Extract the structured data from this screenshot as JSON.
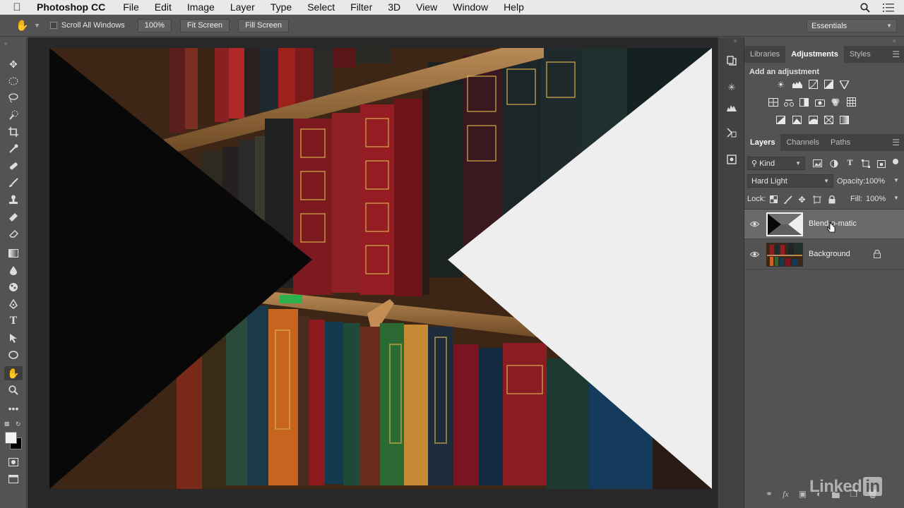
{
  "menubar": {
    "app_name": "Photoshop CC",
    "items": [
      "File",
      "Edit",
      "Image",
      "Layer",
      "Type",
      "Select",
      "Filter",
      "3D",
      "View",
      "Window",
      "Help"
    ]
  },
  "options": {
    "scroll_all_windows": "Scroll All Windows",
    "zoom": "100%",
    "fit_screen": "Fit Screen",
    "fill_screen": "Fill Screen",
    "workspace": "Essentials"
  },
  "adjust_panel": {
    "tabs": [
      "Libraries",
      "Adjustments",
      "Styles"
    ],
    "active_tab": "Adjustments",
    "title": "Add an adjustment"
  },
  "layers_panel": {
    "tabs": [
      "Layers",
      "Channels",
      "Paths"
    ],
    "active_tab": "Layers",
    "filter_kind": "Kind",
    "blend_mode": "Hard Light",
    "opacity_label": "Opacity:",
    "opacity_value": "100%",
    "lock_label": "Lock:",
    "fill_label": "Fill:",
    "fill_value": "100%",
    "layers": [
      {
        "name": "Blend-o-matic",
        "selected": true
      },
      {
        "name": "Background",
        "selected": false,
        "locked": true
      }
    ]
  },
  "watermark": {
    "text": "Linked",
    "badge": "in"
  }
}
